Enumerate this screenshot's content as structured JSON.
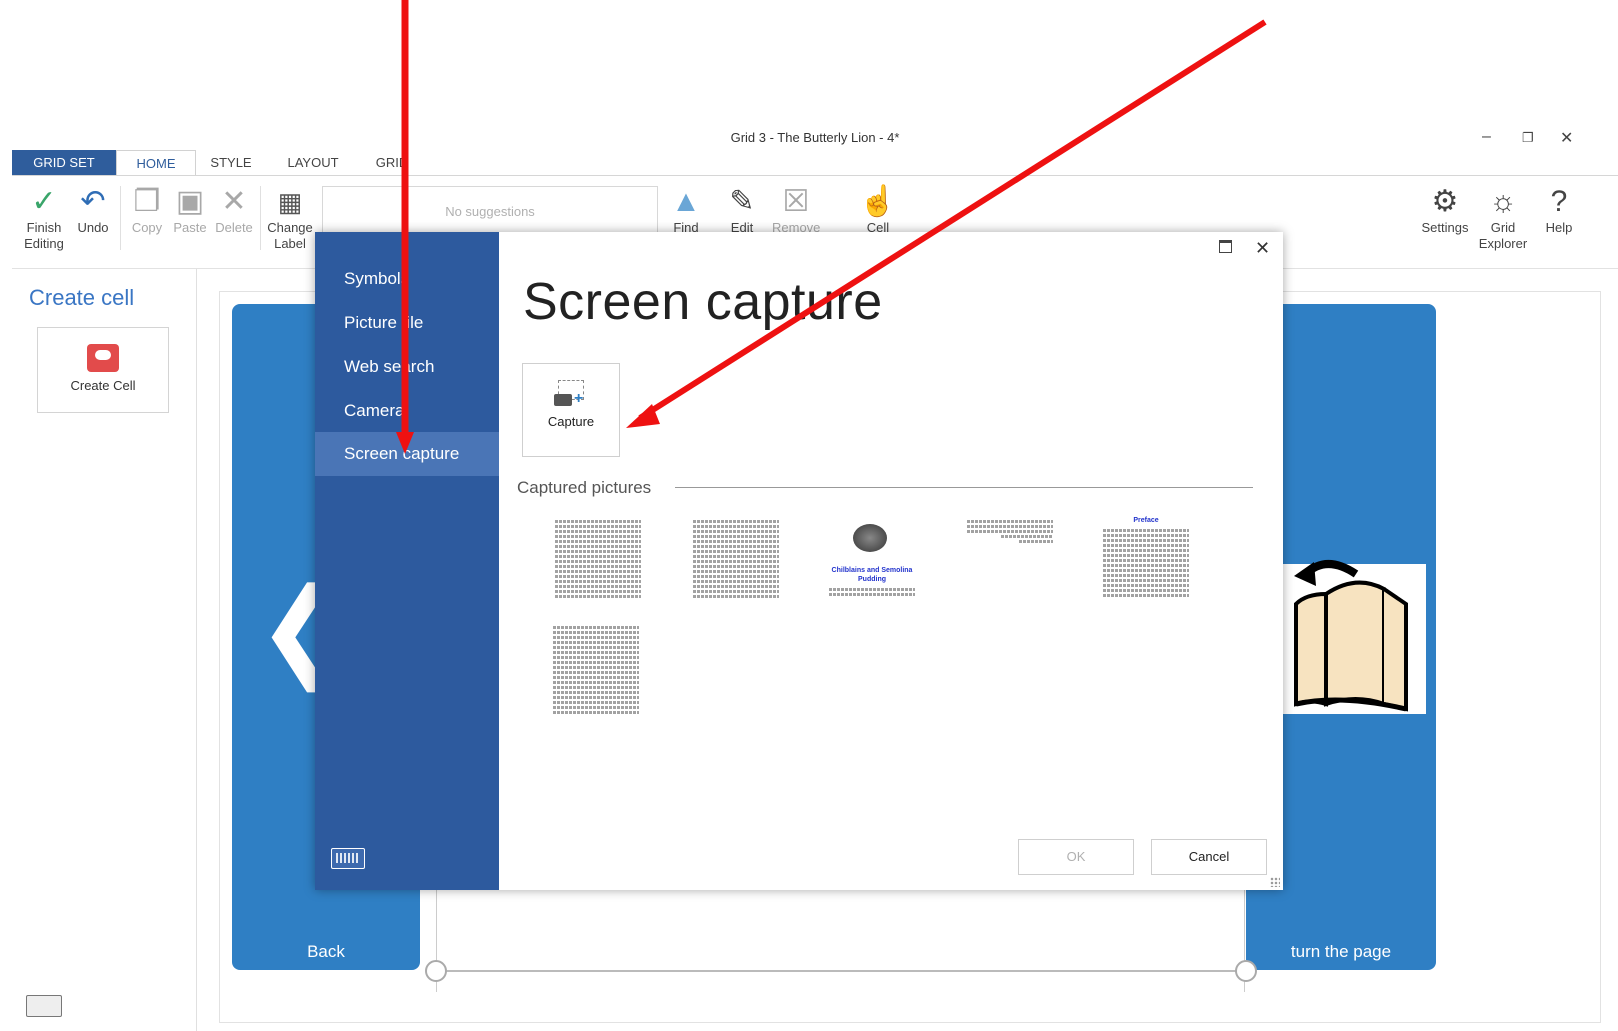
{
  "window": {
    "title": "Grid 3 - The Butterly Lion - 4*",
    "controls": [
      "minimize",
      "restore",
      "close"
    ]
  },
  "ribbon_tabs": [
    {
      "label": "GRID SET",
      "active": false
    },
    {
      "label": "HOME",
      "active": true
    },
    {
      "label": "STYLE",
      "active": false
    },
    {
      "label": "LAYOUT",
      "active": false
    },
    {
      "label": "GRID",
      "active": false
    }
  ],
  "ribbon": {
    "finish_editing": "Finish Editing",
    "undo": "Undo",
    "copy": "Copy",
    "paste": "Paste",
    "delete": "Delete",
    "change_label": "Change Label",
    "suggestions_placeholder": "No suggestions",
    "find": "Find",
    "edit": "Edit",
    "remove": "Remove",
    "cell": "Cell",
    "settings": "Settings",
    "grid_explorer": "Grid Explorer",
    "help": "Help"
  },
  "left_panel": {
    "heading": "Create cell",
    "create_cell_label": "Create Cell"
  },
  "grid": {
    "back_label": "Back",
    "turn_page_label": "turn the page"
  },
  "dialog": {
    "title": "Screen capture",
    "nav": [
      {
        "label": "Symbols",
        "active": false
      },
      {
        "label": "Picture file",
        "active": false
      },
      {
        "label": "Web search",
        "active": false
      },
      {
        "label": "Camera",
        "active": false
      },
      {
        "label": "Screen capture",
        "active": true
      }
    ],
    "capture_button": "Capture",
    "captured_heading": "Captured pictures",
    "thumbnail_titles": [
      "",
      "",
      "Chilblains and Semolina Pudding",
      "",
      "Preface",
      ""
    ],
    "ok_label": "OK",
    "cancel_label": "Cancel"
  },
  "colors": {
    "ribbon_blue": "#2f5d9c",
    "dialog_sidebar": "#2d5a9e",
    "cell_blue": "#2f7fc4",
    "annotation_red": "#ee1111"
  }
}
